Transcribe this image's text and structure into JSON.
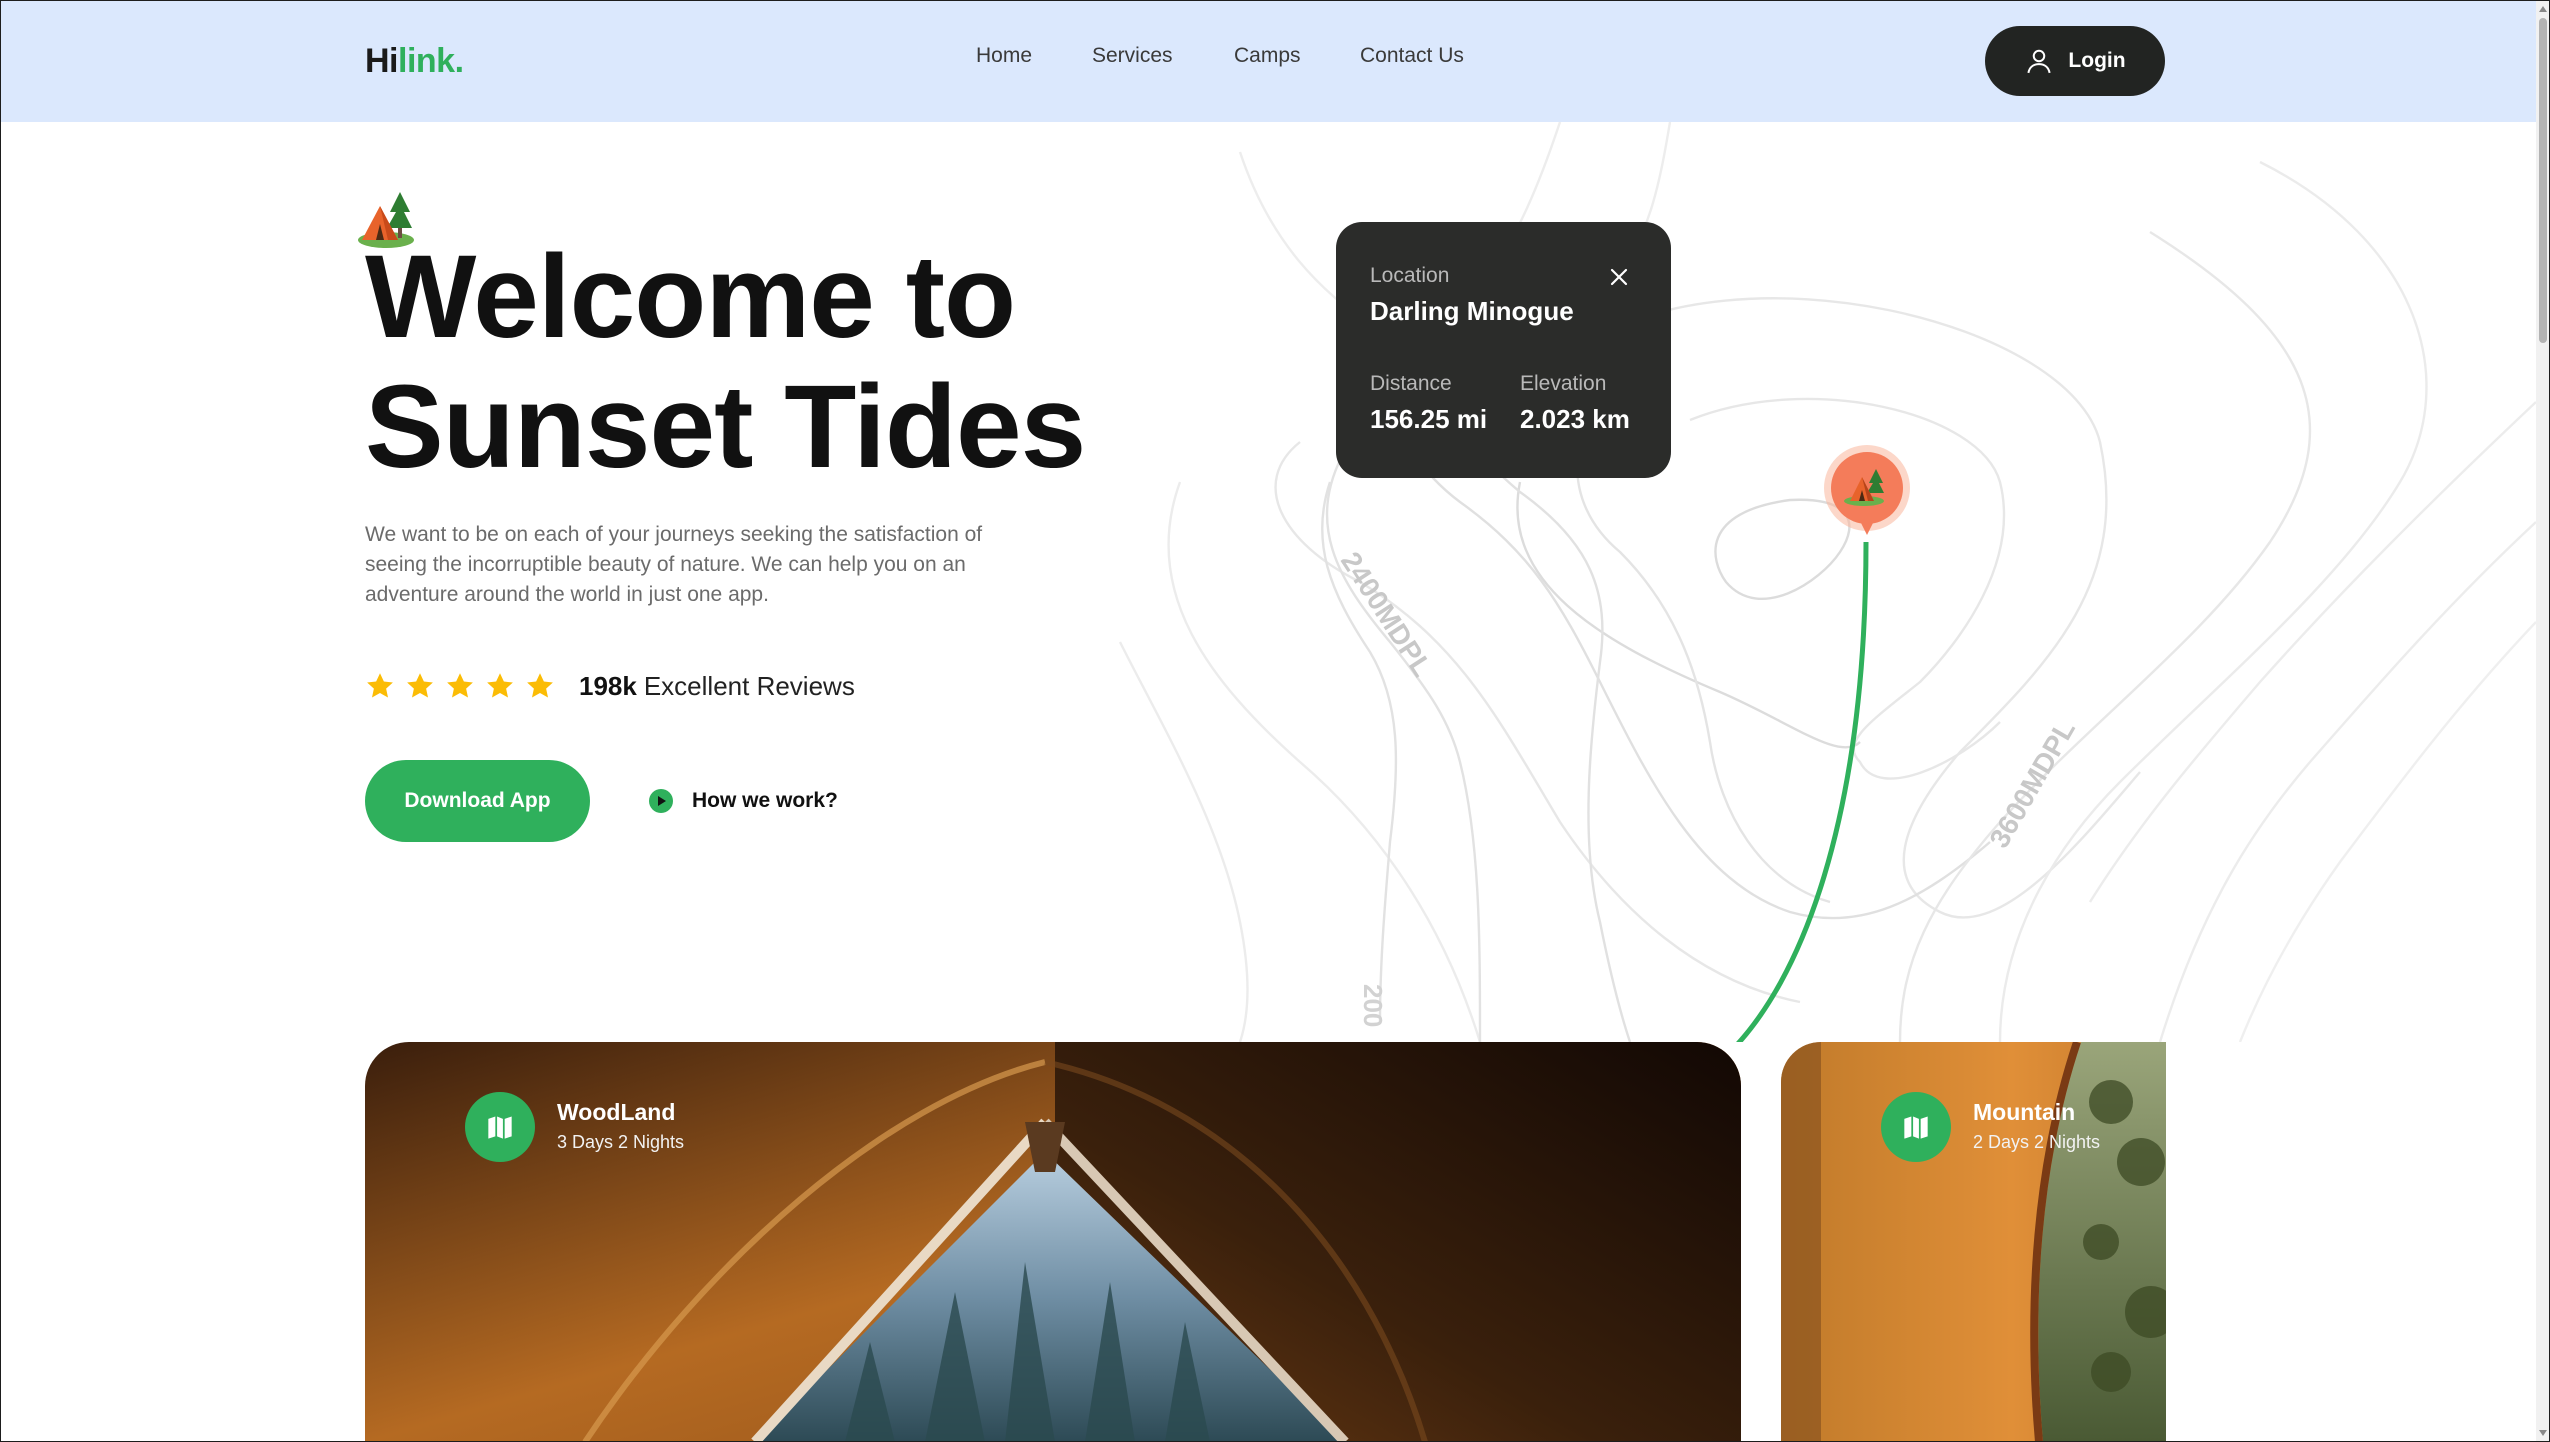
{
  "brand": {
    "prefix": "Hi",
    "accent": "link.",
    "accent_color": "#2fb05c"
  },
  "nav": {
    "items": [
      {
        "label": "Home"
      },
      {
        "label": "Services"
      },
      {
        "label": "Camps"
      },
      {
        "label": "Contact Us"
      }
    ],
    "login_label": "Login"
  },
  "hero": {
    "title_line1": "Welcome to",
    "title_line2": "Sunset Tides",
    "description": "We want to be on each of your journeys seeking the satisfaction of seeing the incorruptible beauty of nature. We can help you on an adventure around the world in just one app.",
    "rating_stars": 5,
    "reviews_count": "198k",
    "reviews_label": "Excellent Reviews",
    "download_label": "Download App",
    "how_label": "How we work?"
  },
  "map": {
    "contour_labels": [
      "2400MDPL",
      "3600MDPL",
      "200"
    ],
    "route_color": "#2fb05c",
    "pin_color": "#f47c5a"
  },
  "location_card": {
    "location_label": "Location",
    "location_name": "Darling Minogue",
    "distance_label": "Distance",
    "distance_value": "156.25 mi",
    "elevation_label": "Elevation",
    "elevation_value": "2.023 km"
  },
  "camps": [
    {
      "title": "WoodLand",
      "duration": "3 Days 2 Nights",
      "icon": "map-icon"
    },
    {
      "title": "Mountain",
      "duration": "2 Days 2 Nights",
      "icon": "map-icon"
    }
  ],
  "colors": {
    "header_bg": "#dbe8fd",
    "dark": "#222422",
    "star": "#fbbc05"
  }
}
